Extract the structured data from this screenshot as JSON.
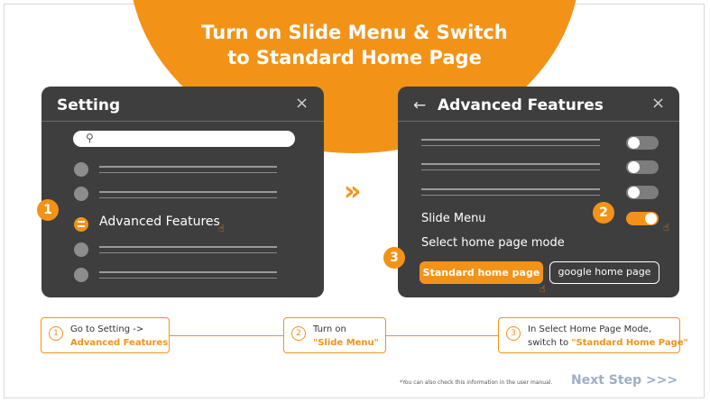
{
  "title": {
    "line1": "Turn on Slide Menu & Switch",
    "line2": "to Standard Home Page"
  },
  "setting_panel": {
    "title": "Setting",
    "close_icon": "×",
    "search_icon": "magnifier",
    "items": [
      "",
      "",
      "Advanced Features",
      "",
      ""
    ],
    "badge": "1"
  },
  "advanced_panel": {
    "back_icon": "←",
    "title": "Advanced Features",
    "close_icon": "×",
    "toggles": [
      false,
      false,
      false
    ],
    "slide_menu_label": "Slide Menu",
    "slide_menu_on": true,
    "badge_slide": "2",
    "select_label": "Select home page mode",
    "badge_select": "3",
    "standard_button": "Standard home page",
    "google_button": "google home page"
  },
  "arrow_icon": "»",
  "hand_icon": "pointing-hand",
  "steps": [
    {
      "num": "1",
      "line1": "Go to Setting ->",
      "line2": "Advanced Features"
    },
    {
      "num": "2",
      "line1": "Turn on",
      "line2": "\"Slide Menu\""
    },
    {
      "num": "3",
      "line1": "In Select Home Page Mode,",
      "line2_prefix": "switch to ",
      "line2": "\"Standard Home Page\""
    }
  ],
  "footnote": "*You can also check this information in the user manual.",
  "next_step": "Next Step >>>",
  "colors": {
    "accent": "#f29318",
    "panel": "#3e3e3e",
    "link": "#9eaec6"
  }
}
